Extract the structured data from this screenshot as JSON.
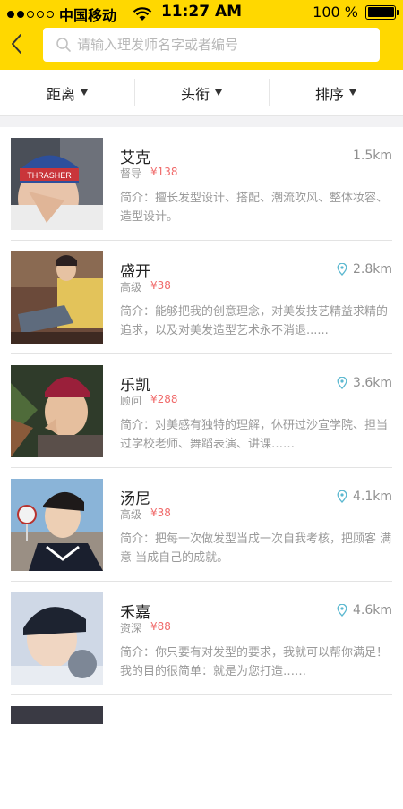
{
  "status_bar": {
    "carrier": "中国移动",
    "time": "11:27 AM",
    "battery": "100 %",
    "signal_dots_filled": 2,
    "signal_dots_total": 5
  },
  "header": {
    "back_icon": "chevron-left-icon",
    "search_placeholder": "请输入理发师名字或者编号",
    "accent_color": "#ffd800"
  },
  "filters": [
    {
      "label": "距离"
    },
    {
      "label": "头衔"
    },
    {
      "label": "排序"
    }
  ],
  "barbers": [
    {
      "name": "艾克",
      "title": "督导",
      "price": "¥138",
      "distance": "1.5km",
      "show_pin": false,
      "intro": "简介：擅长发型设计、搭配、潮流吹风、整体妆容、造型设计。"
    },
    {
      "name": "盛开",
      "title": "高级",
      "price": "¥38",
      "distance": "2.8km",
      "show_pin": true,
      "intro": "简介：能够把我的创意理念，对美发技艺精益求精的追求，以及对美发造型艺术永不消退......"
    },
    {
      "name": "乐凯",
      "title": "顾问",
      "price": "¥288",
      "distance": "3.6km",
      "show_pin": true,
      "intro": "简介：对美感有独特的理解，休研过沙宣学院、担当过学校老师、舞蹈表演、讲课……"
    },
    {
      "name": "汤尼",
      "title": "高级",
      "price": "¥38",
      "distance": "4.1km",
      "show_pin": true,
      "intro": "简介：把每一次做发型当成一次自我考核，把顾客 满意 当成自己的成就。"
    },
    {
      "name": "禾嘉",
      "title": "资深",
      "price": "¥88",
      "distance": "4.6km",
      "show_pin": true,
      "intro": "简介：你只要有对发型的要求，我就可以帮你满足！我的目的很简单：就是为您打造……"
    }
  ]
}
